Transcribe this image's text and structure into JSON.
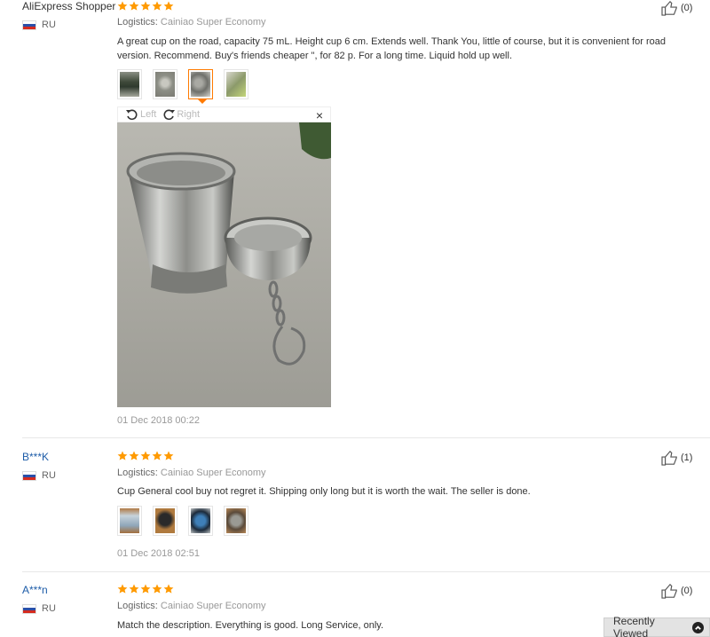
{
  "reviews": [
    {
      "user": "AliExpress Shopper",
      "country": "RU",
      "rating": 5,
      "logistics_label": "Logistics:",
      "logistics": "Cainiao Super Economy",
      "text": "A great cup on the road, capacity 75 mL. Height cup 6 cm. Extends well. Thank You, little of course, but it is convenient for road version. Recommend. Buy's friends cheaper \", for 82 p. For a long time. Liquid hold up well.",
      "helpful": "(0)",
      "photos": 4,
      "active_photo": 3,
      "date": "01 Dec 2018 00:22"
    },
    {
      "user": "B***K",
      "country": "RU",
      "rating": 5,
      "logistics_label": "Logistics:",
      "logistics": "Cainiao Super Economy",
      "text": "Cup General cool buy not regret it. Shipping only long but it is worth the wait. The seller is done.",
      "helpful": "(1)",
      "photos": 4,
      "date": "01 Dec 2018 02:51"
    },
    {
      "user": "A***n",
      "country": "RU",
      "rating": 5,
      "logistics_label": "Logistics:",
      "logistics": "Cainiao Super Economy",
      "text": "Match the description. Everything is good. Long Service, only.",
      "helpful": "(0)"
    }
  ],
  "viewer": {
    "rotate_left": "Left",
    "rotate_right": "Right",
    "close": "×"
  },
  "recently_viewed": "Recently Viewed",
  "colors": {
    "star": "#ff9a00",
    "active_border": "#ff7a00",
    "link": "#1d5ca8"
  },
  "icons": [
    "star-icon",
    "thumbs-up-icon",
    "flag-ru-icon",
    "rotate-left-icon",
    "rotate-right-icon",
    "close-icon",
    "chevron-up-icon"
  ]
}
